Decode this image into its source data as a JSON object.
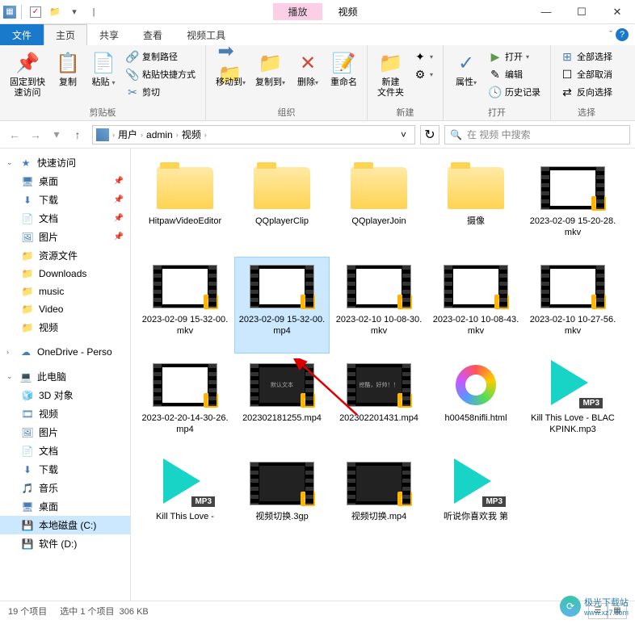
{
  "window": {
    "play_tab": "播放",
    "title": "视频",
    "min": "—",
    "max": "☐",
    "close": "✕"
  },
  "tabs": {
    "file": "文件",
    "home": "主页",
    "share": "共享",
    "view": "查看",
    "video_tools": "视频工具"
  },
  "ribbon": {
    "pin": "固定到快\n速访问",
    "copy": "复制",
    "paste": "粘贴",
    "copy_path": "复制路径",
    "paste_shortcut": "粘贴快捷方式",
    "cut": "剪切",
    "clipboard_label": "剪贴板",
    "move_to": "移动到",
    "copy_to": "复制到",
    "delete": "删除",
    "rename": "重命名",
    "organize_label": "组织",
    "new_folder": "新建\n文件夹",
    "new_label": "新建",
    "properties": "属性",
    "open": "打开",
    "edit": "编辑",
    "history": "历史记录",
    "open_label": "打开",
    "select_all": "全部选择",
    "select_none": "全部取消",
    "invert": "反向选择",
    "select_label": "选择"
  },
  "breadcrumb": {
    "seg1": "用户",
    "seg2": "admin",
    "seg3": "视频"
  },
  "search": {
    "placeholder": "在 视频 中搜索"
  },
  "sidebar": {
    "quick_access": "快速访问",
    "desktop": "桌面",
    "downloads": "下载",
    "documents": "文档",
    "pictures": "图片",
    "resources": "资源文件",
    "downloads_en": "Downloads",
    "music_en": "music",
    "video_en": "Video",
    "videos": "视频",
    "onedrive": "OneDrive - Perso",
    "this_pc": "此电脑",
    "objects_3d": "3D 对象",
    "pc_videos": "视频",
    "pc_pictures": "图片",
    "pc_documents": "文档",
    "pc_downloads": "下载",
    "pc_music": "音乐",
    "pc_desktop": "桌面",
    "drive_c": "本地磁盘 (C:)",
    "drive_d": "软件 (D:)"
  },
  "files": [
    {
      "name": "HitpawVideoEditor",
      "type": "folder"
    },
    {
      "name": "QQplayerClip",
      "type": "folder"
    },
    {
      "name": "QQplayerJoin",
      "type": "folder"
    },
    {
      "name": "摄像",
      "type": "folder"
    },
    {
      "name": "2023-02-09 15-20-28.mkv",
      "type": "video",
      "preview": "white"
    },
    {
      "name": "2023-02-09 15-32-00.mkv",
      "type": "video",
      "preview": "white"
    },
    {
      "name": "2023-02-09 15-32-00.mp4",
      "type": "video",
      "preview": "white",
      "selected": true
    },
    {
      "name": "2023-02-10 10-08-30.mkv",
      "type": "video",
      "preview": "white"
    },
    {
      "name": "2023-02-10 10-08-43.mkv",
      "type": "video",
      "preview": "white"
    },
    {
      "name": "2023-02-10 10-27-56.mkv",
      "type": "video",
      "preview": "white"
    },
    {
      "name": "2023-02-20-14-30-26.mp4",
      "type": "video",
      "preview": "white"
    },
    {
      "name": "202302181255.mp4",
      "type": "video",
      "preview": "dark",
      "text": "默认文本"
    },
    {
      "name": "202302201431.mp4",
      "type": "video",
      "preview": "dark",
      "text": "挖酷，好帅！！"
    },
    {
      "name": "h00458nifli.html",
      "type": "html"
    },
    {
      "name": "Kill This Love - BLACKPINK.mp3",
      "type": "mp3"
    },
    {
      "name": "Kill This Love - ",
      "type": "mp3"
    },
    {
      "name": "视频切换.3gp",
      "type": "video",
      "preview": "dark"
    },
    {
      "name": "视频切换.mp4",
      "type": "video",
      "preview": "dark"
    },
    {
      "name": "听说你喜欢我 第",
      "type": "mp3"
    }
  ],
  "status": {
    "count": "19 个项目",
    "selected": "选中 1 个项目",
    "size": "306 KB"
  },
  "watermark": {
    "text1": "极光下载站",
    "text2": "www.xz7.com"
  },
  "mp3_badge": "MP3"
}
